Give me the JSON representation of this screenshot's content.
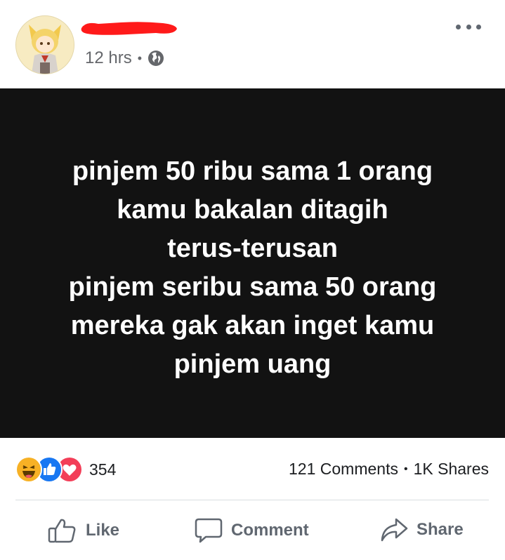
{
  "post": {
    "time": "12 hrs",
    "separator": "•",
    "privacy_icon": "globe-icon",
    "more_icon": "more-horizontal-icon",
    "content_lines": [
      "pinjem 50 ribu sama 1 orang",
      "kamu bakalan ditagih",
      "terus-terusan",
      "pinjem seribu sama 50 orang",
      "mereka gak akan inget kamu",
      "pinjem uang"
    ],
    "content_background": "#121212",
    "content_text_color": "#ffffff"
  },
  "stats": {
    "reaction_icons": [
      "haha-icon",
      "like-icon",
      "love-icon"
    ],
    "reaction_count": "354",
    "comments": "121 Comments",
    "separator": "•",
    "shares": "1K Shares"
  },
  "actions": {
    "like_label": "Like",
    "comment_label": "Comment",
    "share_label": "Share"
  },
  "colors": {
    "redaction": "#ff1a1a",
    "like_blue": "#1877f2",
    "love_red": "#f33e58",
    "haha_yellow": "#f7b125"
  }
}
